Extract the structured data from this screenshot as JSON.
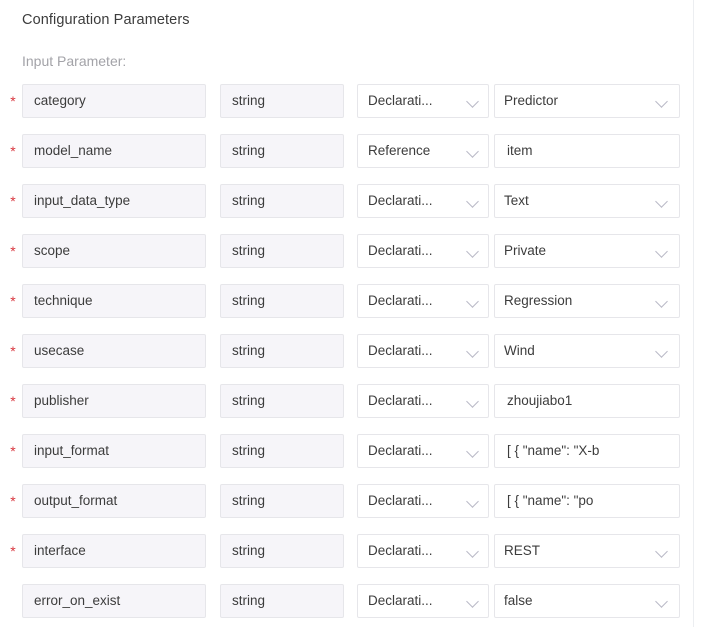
{
  "section": {
    "title": "Configuration Parameters",
    "group_label": "Input Parameter:"
  },
  "icons": {
    "required": "*",
    "chevron": "chevron-down-icon"
  },
  "colors": {
    "required_star": "#d9363e",
    "field_fill": "#f6f5f9",
    "field_border": "#e6e6ea",
    "text": "#3c3c3c",
    "muted_text": "#a3a3a8"
  },
  "parameters": [
    {
      "required": true,
      "name": "category",
      "type": "string",
      "kind": "Declarati...",
      "kind_is_select": true,
      "value": "Predictor",
      "value_is_select": true
    },
    {
      "required": true,
      "name": "model_name",
      "type": "string",
      "kind": "Reference",
      "kind_is_select": true,
      "value": "item",
      "value_is_select": false
    },
    {
      "required": true,
      "name": "input_data_type",
      "type": "string",
      "kind": "Declarati...",
      "kind_is_select": true,
      "value": "Text",
      "value_is_select": true
    },
    {
      "required": true,
      "name": "scope",
      "type": "string",
      "kind": "Declarati...",
      "kind_is_select": true,
      "value": "Private",
      "value_is_select": true
    },
    {
      "required": true,
      "name": "technique",
      "type": "string",
      "kind": "Declarati...",
      "kind_is_select": true,
      "value": "Regression",
      "value_is_select": true
    },
    {
      "required": true,
      "name": "usecase",
      "type": "string",
      "kind": "Declarati...",
      "kind_is_select": true,
      "value": "Wind",
      "value_is_select": true
    },
    {
      "required": true,
      "name": "publisher",
      "type": "string",
      "kind": "Declarati...",
      "kind_is_select": true,
      "value": "zhoujiabo1",
      "value_is_select": false
    },
    {
      "required": true,
      "name": "input_format",
      "type": "string",
      "kind": "Declarati...",
      "kind_is_select": true,
      "value": "[    {        \"name\": \"X-b",
      "value_is_select": false
    },
    {
      "required": true,
      "name": "output_format",
      "type": "string",
      "kind": "Declarati...",
      "kind_is_select": true,
      "value": "[    {        \"name\": \"po",
      "value_is_select": false
    },
    {
      "required": true,
      "name": "interface",
      "type": "string",
      "kind": "Declarati...",
      "kind_is_select": true,
      "value": "REST",
      "value_is_select": true
    },
    {
      "required": false,
      "name": "error_on_exist",
      "type": "string",
      "kind": "Declarati...",
      "kind_is_select": true,
      "value": "false",
      "value_is_select": true
    }
  ]
}
